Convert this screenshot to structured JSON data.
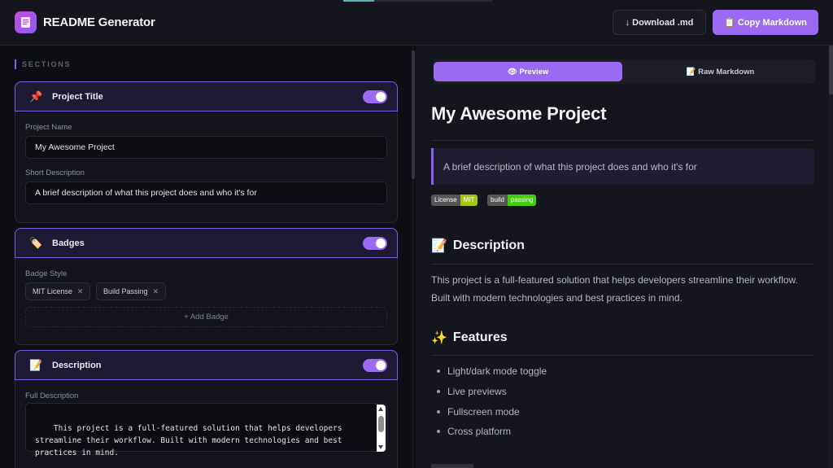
{
  "app": {
    "title": "README Generator"
  },
  "header": {
    "download_label": "↓ Download .md",
    "copy_label": "📋 Copy Markdown"
  },
  "sidebar": {
    "sections_label": "SECTIONS",
    "project_title": {
      "icon": "📌",
      "title": "Project Title",
      "enabled": true,
      "name_label": "Project Name",
      "name_value": "My Awesome Project",
      "desc_label": "Short Description",
      "desc_value": "A brief description of what this project does and who it's for"
    },
    "badges": {
      "icon": "🏷️",
      "title": "Badges",
      "enabled": true,
      "style_label": "Badge Style",
      "chips": [
        "MIT License",
        "Build Passing"
      ],
      "add_label": "+ Add Badge"
    },
    "description": {
      "icon": "📝",
      "title": "Description",
      "enabled": true,
      "full_label": "Full Description",
      "full_value": "This project is a full-featured solution that helps developers\nstreamline their workflow. Built with modern technologies and best\npractices in mind."
    }
  },
  "preview": {
    "tab_preview": "👁 Preview",
    "tab_raw": "📝 Raw Markdown",
    "title": "My Awesome Project",
    "quote": "A brief description of what this project does and who it's for",
    "shields": [
      {
        "label": "License",
        "value": "MIT",
        "color": "#a4c612"
      },
      {
        "label": "build",
        "value": "passing",
        "color": "#44cc11"
      }
    ],
    "description_heading": "Description",
    "description_icon": "📝",
    "description_text": "This project is a full-featured solution that helps developers streamline their workflow. Built with modern technologies and best practices in mind.",
    "features_heading": "Features",
    "features_icon": "✨",
    "features": [
      "Light/dark mode toggle",
      "Live previews",
      "Fullscreen mode",
      "Cross platform"
    ]
  },
  "colors": {
    "accent": "#9a6af2",
    "background": "#0e0f15",
    "panel": "#14151d"
  }
}
